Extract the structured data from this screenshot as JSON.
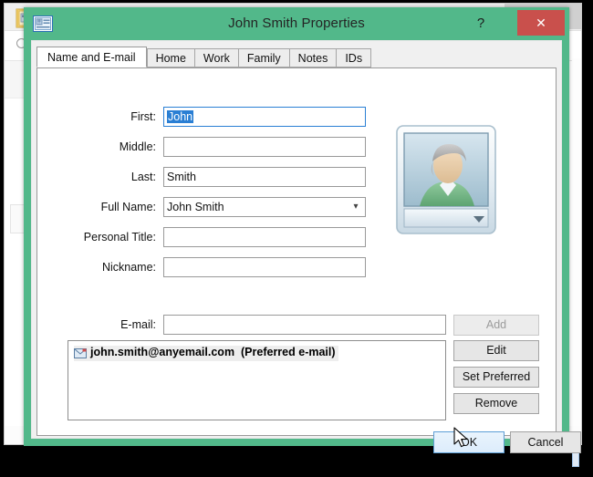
{
  "background_window": {
    "folder_icon": "contacts-folder-icon",
    "minimize_glyph": "–",
    "maximize_glyph": "☐",
    "close_glyph": "✕",
    "search_icon": "search-icon"
  },
  "dialog": {
    "icon": "contact-card-icon",
    "title": "John Smith Properties",
    "help_label": "?",
    "close_label": "✕",
    "accent_green": "#52b88a",
    "close_red": "#c9504c",
    "selection_blue": "#2a7fd4"
  },
  "tabs": [
    {
      "label": "Name and E-mail",
      "active": true
    },
    {
      "label": "Home",
      "active": false
    },
    {
      "label": "Work",
      "active": false
    },
    {
      "label": "Family",
      "active": false
    },
    {
      "label": "Notes",
      "active": false
    },
    {
      "label": "IDs",
      "active": false
    }
  ],
  "form": {
    "fields": [
      {
        "label": "First:",
        "value": "John",
        "type": "text",
        "selected": true,
        "focused": true
      },
      {
        "label": "Middle:",
        "value": "",
        "type": "text",
        "selected": false,
        "focused": false
      },
      {
        "label": "Last:",
        "value": "Smith",
        "type": "text",
        "selected": false,
        "focused": false
      },
      {
        "label": "Full Name:",
        "value": "John Smith",
        "type": "combo",
        "selected": false,
        "focused": false
      },
      {
        "label": "Personal Title:",
        "value": "",
        "type": "text",
        "selected": false,
        "focused": false
      },
      {
        "label": "Nickname:",
        "value": "",
        "type": "text",
        "selected": false,
        "focused": false
      }
    ],
    "avatar": {
      "icon": "user-avatar-picture",
      "dropdown_glyph": "▼"
    }
  },
  "email": {
    "label": "E-mail:",
    "input_value": "",
    "list": [
      {
        "icon": "envelope-icon",
        "address": "john.smith@anyemail.com",
        "tag": "(Preferred e-mail)"
      }
    ],
    "buttons": [
      {
        "label": "Add",
        "disabled": true
      },
      {
        "label": "Edit",
        "disabled": false
      },
      {
        "label": "Set Preferred",
        "disabled": false
      },
      {
        "label": "Remove",
        "disabled": false
      }
    ]
  },
  "footer": {
    "ok_label": "OK",
    "cancel_label": "Cancel"
  }
}
